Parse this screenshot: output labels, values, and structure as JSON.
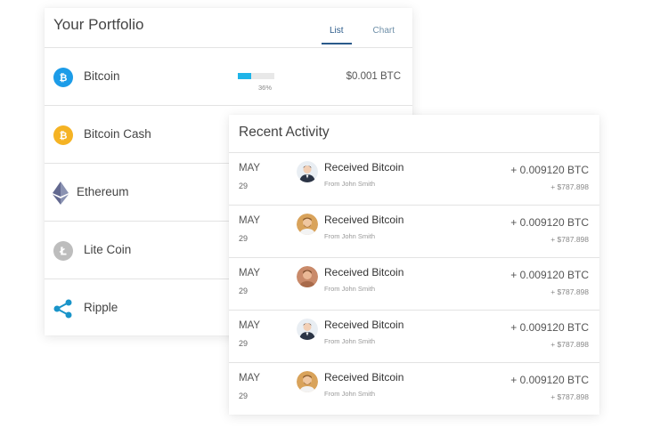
{
  "portfolio": {
    "title": "Your Portfolio",
    "tabs": [
      {
        "label": "List",
        "active": true
      },
      {
        "label": "Chart",
        "active": false
      }
    ],
    "coins": [
      {
        "name": "Bitcoin",
        "icon": "bitcoin-icon",
        "color": "#1c9ce8",
        "progress_percent": 36,
        "progress_label": "36%",
        "amount": "$0.001 BTC"
      },
      {
        "name": "Bitcoin Cash",
        "icon": "bitcoin-cash-icon",
        "color": "#f5b324"
      },
      {
        "name": "Ethereum",
        "icon": "ethereum-icon",
        "color": "#6d7ccf"
      },
      {
        "name": "Lite Coin",
        "icon": "litecoin-icon",
        "color": "#bdbdbd"
      },
      {
        "name": "Ripple",
        "icon": "ripple-icon",
        "color": "#1994c9"
      }
    ]
  },
  "activity": {
    "title": "Recent Activity",
    "items": [
      {
        "month": "MAY",
        "day": "29",
        "label": "Received Bitcoin",
        "from": "From John Smith",
        "amount": "+ 0.009120 BTC",
        "usd": "+ $787.898",
        "avatar": "avatar-man-suit"
      },
      {
        "month": "MAY",
        "day": "29",
        "label": "Received Bitcoin",
        "from": "From John Smith",
        "amount": "+ 0.009120 BTC",
        "usd": "+ $787.898",
        "avatar": "avatar-man-beard"
      },
      {
        "month": "MAY",
        "day": "29",
        "label": "Received Bitcoin",
        "from": "From John Smith",
        "amount": "+ 0.009120 BTC",
        "usd": "+ $787.898",
        "avatar": "avatar-man-brown"
      },
      {
        "month": "MAY",
        "day": "29",
        "label": "Received Bitcoin",
        "from": "From John Smith",
        "amount": "+ 0.009120 BTC",
        "usd": "+ $787.898",
        "avatar": "avatar-man-suit"
      },
      {
        "month": "MAY",
        "day": "29",
        "label": "Received Bitcoin",
        "from": "From John Smith",
        "amount": "+ 0.009120 BTC",
        "usd": "+ $787.898",
        "avatar": "avatar-man-beard"
      }
    ]
  }
}
